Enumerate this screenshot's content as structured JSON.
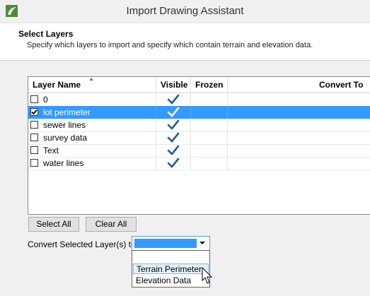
{
  "window": {
    "title": "Import Drawing Assistant",
    "icon": "app-leaf-icon"
  },
  "header": {
    "title": "Select Layers",
    "subtitle": "Specify which layers to import and specify which contain terrain and elevation data."
  },
  "table": {
    "columns": [
      "Layer Name",
      "Visible",
      "Frozen",
      "Convert To"
    ],
    "rows": [
      {
        "name": "0",
        "checked": false,
        "visible": true,
        "selected": false
      },
      {
        "name": "lot perimeter",
        "checked": true,
        "visible": true,
        "selected": true
      },
      {
        "name": "sewer lines",
        "checked": false,
        "visible": true,
        "selected": false
      },
      {
        "name": "survey data",
        "checked": false,
        "visible": true,
        "selected": false
      },
      {
        "name": "Text",
        "checked": false,
        "visible": true,
        "selected": false
      },
      {
        "name": "water lines",
        "checked": false,
        "visible": true,
        "selected": false
      }
    ]
  },
  "buttons": {
    "select_all": "Select All",
    "clear_all": "Clear All"
  },
  "convert": {
    "label": "Convert Selected Layer(s) to:",
    "value": "",
    "options": [
      "",
      "Terrain Perimeter",
      "Elevation Data"
    ],
    "highlighted": "Terrain Perimeter"
  },
  "colors": {
    "selection": "#3399ff",
    "check": "#1d5f8a",
    "accent": "#569de5"
  }
}
